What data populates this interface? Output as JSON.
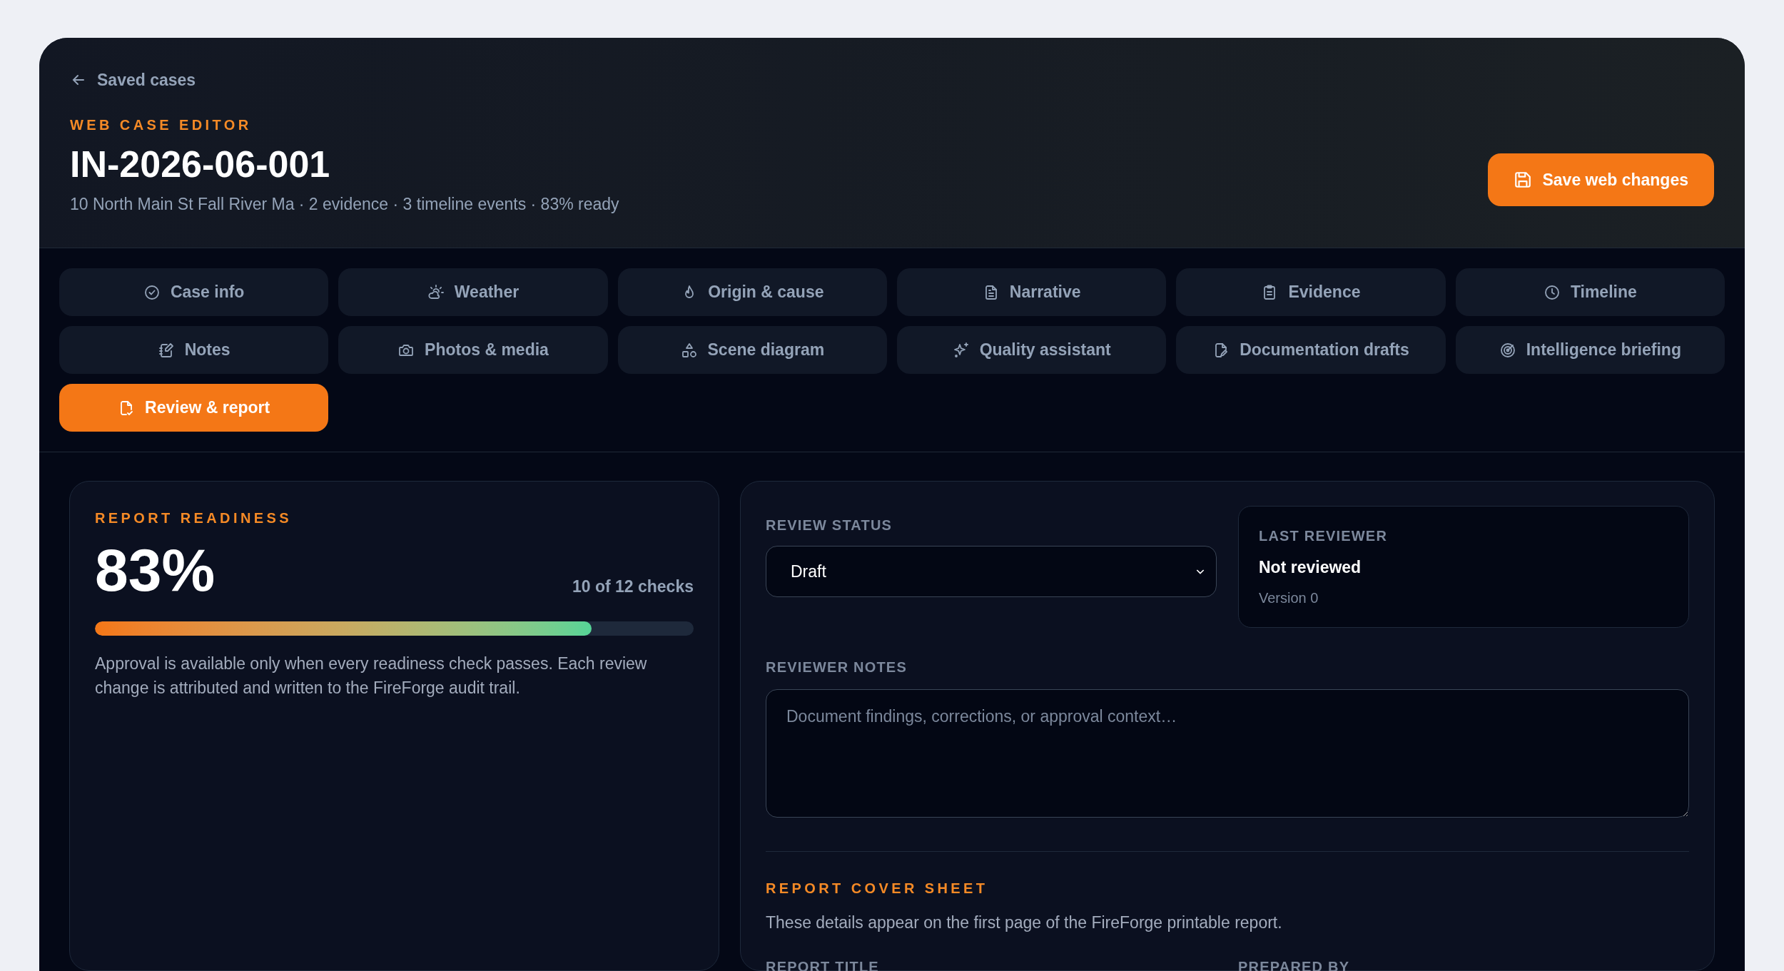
{
  "back_link": {
    "label": "Saved cases"
  },
  "header": {
    "eyebrow": "WEB CASE EDITOR",
    "title": "IN-2026-06-001",
    "subtitle": "10 North Main St Fall River Ma · 2 evidence · 3 timeline events · 83% ready"
  },
  "save_button": {
    "label": "Save web changes"
  },
  "tabs": [
    {
      "label": "Case info",
      "selected": false
    },
    {
      "label": "Weather",
      "selected": false
    },
    {
      "label": "Origin & cause",
      "selected": false
    },
    {
      "label": "Narrative",
      "selected": false
    },
    {
      "label": "Evidence",
      "selected": false
    },
    {
      "label": "Timeline",
      "selected": false
    },
    {
      "label": "Notes",
      "selected": false
    },
    {
      "label": "Photos & media",
      "selected": false
    },
    {
      "label": "Scene diagram",
      "selected": false
    },
    {
      "label": "Quality assistant",
      "selected": false
    },
    {
      "label": "Documentation drafts",
      "selected": false
    },
    {
      "label": "Intelligence briefing",
      "selected": false
    },
    {
      "label": "Review & report",
      "selected": true
    }
  ],
  "readiness": {
    "eyebrow": "REPORT READINESS",
    "percent": "83%",
    "checks": "10 of 12 checks",
    "level": 0.83,
    "description": "Approval is available only when every readiness check passes. Each review change is attributed and written to the FireForge audit trail."
  },
  "review": {
    "status_label": "REVIEW STATUS",
    "status_value": "Draft",
    "last_reviewer": {
      "label": "LAST REVIEWER",
      "name": "Not reviewed",
      "version": "Version 0"
    },
    "notes_label": "REVIEWER NOTES",
    "notes_placeholder": "Document findings, corrections, or approval context…",
    "cover_sheet": {
      "eyebrow": "REPORT COVER SHEET",
      "description": "These details appear on the first page of the FireForge printable report.",
      "field_labels": [
        "REPORT TITLE",
        "PREPARED BY"
      ]
    }
  }
}
